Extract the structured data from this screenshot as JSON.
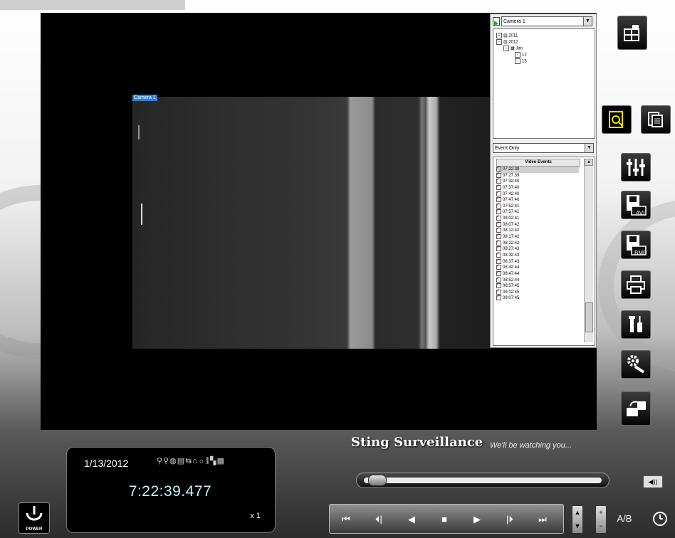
{
  "camera_overlay": "Camera 1",
  "camera_select": {
    "value": "Camera 1"
  },
  "tree": {
    "years": [
      "2011",
      "2012"
    ],
    "month": "Jan",
    "days": [
      "12",
      "13"
    ]
  },
  "filter_select": {
    "value": "Event Only"
  },
  "events": {
    "header": "Video Events",
    "items": [
      "07:22:39",
      "07:27:39",
      "07:32:40",
      "07:37:40",
      "07:42:40",
      "07:47:40",
      "07:52:41",
      "07:57:41",
      "08:02:41",
      "08:07:42",
      "08:12:42",
      "08:17:42",
      "08:22:42",
      "08:27:43",
      "08:32:43",
      "08:37:43",
      "08:42:44",
      "08:47:44",
      "08:52:44",
      "08:57:45",
      "09:02:45",
      "09:07:45"
    ]
  },
  "branding": {
    "name": "Sting Surveillance",
    "tagline": "We'll be watching you..."
  },
  "status": {
    "date": "1/13/2012",
    "time": "7:22:39.477",
    "speed": "x 1"
  },
  "timeline": {
    "position": 0.02
  },
  "side_buttons": [
    {
      "name": "camera-layout-icon",
      "label": ""
    },
    {
      "name": "search-icon",
      "label": ""
    },
    {
      "name": "list-view-icon",
      "label": ""
    },
    {
      "name": "adjust-sliders-icon",
      "label": ""
    },
    {
      "name": "save-avi-icon",
      "label": "AVI"
    },
    {
      "name": "save-bmp-icon",
      "label": "BMP"
    },
    {
      "name": "print-icon",
      "label": ""
    },
    {
      "name": "tools-icon",
      "label": ""
    },
    {
      "name": "settings-icon",
      "label": ""
    },
    {
      "name": "export-icon",
      "label": ""
    }
  ],
  "misc": {
    "power": "POWER",
    "ab": "A/B"
  },
  "colors": {
    "accent": "#2d7fd6",
    "highlight": "#f2e000"
  }
}
